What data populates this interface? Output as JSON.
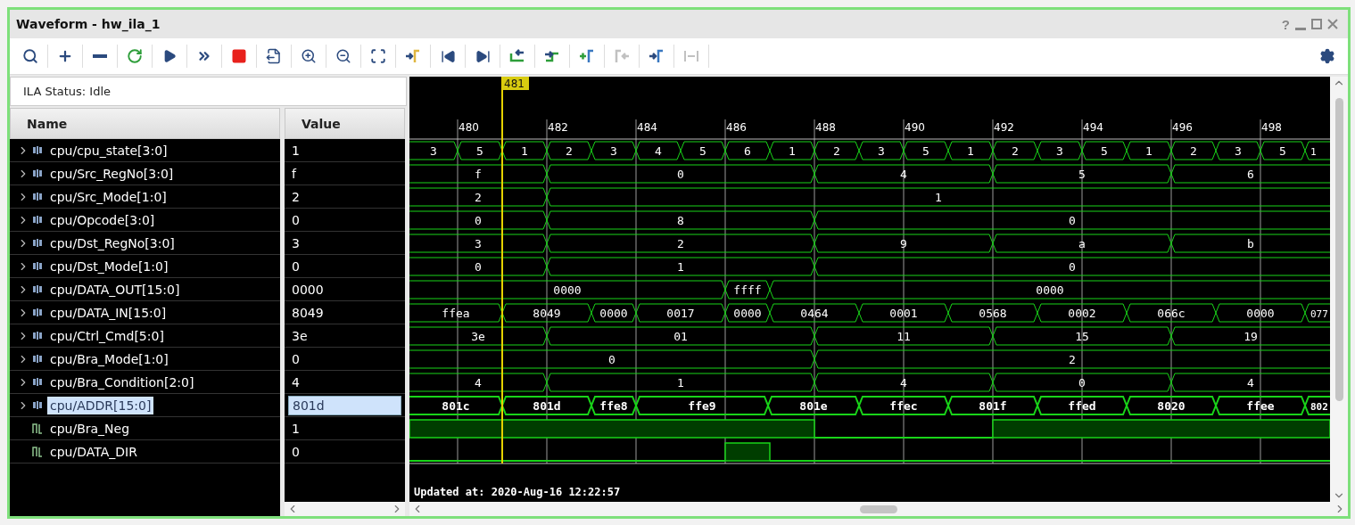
{
  "window": {
    "title": "Waveform - hw_ila_1",
    "help": "?"
  },
  "toolbar": [
    {
      "kind": "search",
      "disabled": false
    },
    {
      "kind": "add",
      "disabled": false
    },
    {
      "kind": "remove",
      "disabled": false
    },
    {
      "kind": "rerun",
      "disabled": false
    },
    {
      "kind": "play",
      "disabled": false
    },
    {
      "kind": "fast",
      "disabled": false
    },
    {
      "kind": "stop",
      "disabled": false
    },
    {
      "kind": "export",
      "disabled": false
    },
    {
      "kind": "zoomin",
      "disabled": false
    },
    {
      "kind": "zoomout",
      "disabled": false
    },
    {
      "kind": "fit",
      "disabled": false
    },
    {
      "kind": "tocursor",
      "disabled": false
    },
    {
      "kind": "first",
      "disabled": false
    },
    {
      "kind": "last",
      "disabled": false
    },
    {
      "kind": "prevedge",
      "disabled": false
    },
    {
      "kind": "nextedge",
      "disabled": false
    },
    {
      "kind": "addmarker",
      "disabled": false
    },
    {
      "kind": "prevmarker",
      "disabled": true
    },
    {
      "kind": "nextmarker",
      "disabled": false
    },
    {
      "kind": "swap",
      "disabled": true
    }
  ],
  "status": "ILA Status: Idle",
  "columns": {
    "name": "Name",
    "value": "Value"
  },
  "timeline": {
    "cursor": "481",
    "ticks": [
      "480",
      "482",
      "484",
      "486",
      "488",
      "490",
      "492",
      "494",
      "496",
      "498"
    ]
  },
  "signals": [
    {
      "kind": "bus",
      "name": "cpu/cpu_state[3:0]",
      "value": "1",
      "expanded": false,
      "selected": false,
      "segments": [
        "3",
        "5",
        "1",
        "2",
        "3",
        "4",
        "5",
        "6",
        "1",
        "2",
        "3",
        "5",
        "1",
        "2",
        "3",
        "5",
        "1",
        "2",
        "3",
        "5",
        "1"
      ]
    },
    {
      "kind": "bus",
      "name": "cpu/Src_RegNo[3:0]",
      "value": "f",
      "expanded": false,
      "selected": false,
      "segments": [
        "f",
        "0",
        "4",
        "5",
        "6"
      ]
    },
    {
      "kind": "bus",
      "name": "cpu/Src_Mode[1:0]",
      "value": "2",
      "expanded": false,
      "selected": false,
      "segments": [
        "2",
        "1"
      ]
    },
    {
      "kind": "bus",
      "name": "cpu/Opcode[3:0]",
      "value": "0",
      "expanded": false,
      "selected": false,
      "segments": [
        "0",
        "8",
        "0"
      ]
    },
    {
      "kind": "bus",
      "name": "cpu/Dst_RegNo[3:0]",
      "value": "3",
      "expanded": false,
      "selected": false,
      "segments": [
        "3",
        "2",
        "9",
        "a",
        "b"
      ]
    },
    {
      "kind": "bus",
      "name": "cpu/Dst_Mode[1:0]",
      "value": "0",
      "expanded": false,
      "selected": false,
      "segments": [
        "0",
        "1",
        "0"
      ]
    },
    {
      "kind": "bus",
      "name": "cpu/DATA_OUT[15:0]",
      "value": "0000",
      "expanded": false,
      "selected": false,
      "segments": [
        "0000",
        "ffff",
        "0000"
      ]
    },
    {
      "kind": "bus",
      "name": "cpu/DATA_IN[15:0]",
      "value": "8049",
      "expanded": false,
      "selected": false,
      "segments": [
        "ffea",
        "8049",
        "0000",
        "0017",
        "0000",
        "0464",
        "0001",
        "0568",
        "0002",
        "066c",
        "0000",
        "077"
      ]
    },
    {
      "kind": "bus",
      "name": "cpu/Ctrl_Cmd[5:0]",
      "value": "3e",
      "expanded": false,
      "selected": false,
      "segments": [
        "3e",
        "01",
        "11",
        "15",
        "19"
      ]
    },
    {
      "kind": "bus",
      "name": "cpu/Bra_Mode[1:0]",
      "value": "0",
      "expanded": false,
      "selected": false,
      "segments": [
        "0",
        "2"
      ]
    },
    {
      "kind": "bus",
      "name": "cpu/Bra_Condition[2:0]",
      "value": "4",
      "expanded": false,
      "selected": false,
      "segments": [
        "4",
        "1",
        "4",
        "0",
        "4"
      ]
    },
    {
      "kind": "bus",
      "name": "cpu/ADDR[15:0]",
      "value": "801d",
      "expanded": false,
      "selected": true,
      "segments": [
        "801c",
        "801d",
        "ffe8",
        "ffe9",
        "801e",
        "ffec",
        "801f",
        "ffed",
        "8020",
        "ffee",
        "802"
      ]
    },
    {
      "kind": "bit",
      "name": "cpu/Bra_Neg",
      "value": "1",
      "selected": false,
      "segments": [
        {
          "high": true
        },
        {
          "high": false
        },
        {
          "high": true
        }
      ]
    },
    {
      "kind": "bit",
      "name": "cpu/DATA_DIR",
      "value": "0",
      "selected": false,
      "segments": [
        {
          "high": false
        },
        {
          "high": true
        },
        {
          "high": false
        }
      ]
    }
  ],
  "updated": "Updated at: 2020-Aug-16 12:22:57"
}
